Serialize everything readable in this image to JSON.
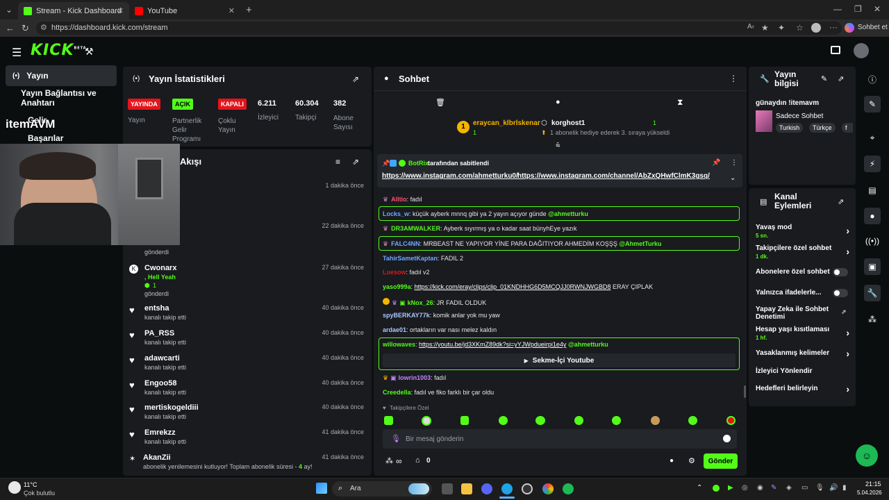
{
  "browser": {
    "tabs": [
      {
        "title": "Stream - Kick Dashboard"
      },
      {
        "title": "YouTube"
      }
    ],
    "url": "https://dashboard.kick.com/stream",
    "profile_label": "Sohbet et"
  },
  "kick": {
    "logo": "KICK",
    "beta": "BETA"
  },
  "sidebar": {
    "items": [
      {
        "label": "Yayın"
      },
      {
        "label": "Yayın Bağlantısı ve Anahtarı"
      },
      {
        "label": "Gelir"
      },
      {
        "label": "Başarılar"
      }
    ],
    "overlay": "itemAVM"
  },
  "stats": {
    "title": "Yayın İstatistikleri",
    "badges": [
      {
        "badge": "YAYINDA",
        "label": "Yayın",
        "color": "#e5141b"
      },
      {
        "badge": "AÇIK",
        "label": "Partnerlik Gelir Programı",
        "color": "#53fc18"
      },
      {
        "badge": "KAPALI",
        "label": "Çoklu Yayın",
        "color": "#e5141b"
      }
    ],
    "numbers": [
      {
        "value": "6.211",
        "label": "İzleyici"
      },
      {
        "value": "60.304",
        "label": "Takipçi"
      },
      {
        "value": "382",
        "label": "Abone Sayısı"
      }
    ]
  },
  "feed": {
    "title": "Akışı",
    "rows": [
      {
        "name": "",
        "sub": "",
        "time": "1 dakika önce"
      },
      {
        "name": "",
        "sub": "gönderdi",
        "time": "22 dakika önce"
      },
      {
        "name": "Cwonarx",
        "extra": ", Hell Yeah",
        "count": "1",
        "sub": "gönderdi",
        "time": "27 dakika önce"
      },
      {
        "name": "entsha",
        "sub": "kanalı takip etti",
        "time": "40 dakika önce"
      },
      {
        "name": "PA_RSS",
        "sub": "kanalı takip etti",
        "time": "40 dakika önce"
      },
      {
        "name": "adawcarti",
        "sub": "kanalı takip etti",
        "time": "40 dakika önce"
      },
      {
        "name": "Engoo58",
        "sub": "kanalı takip etti",
        "time": "40 dakika önce"
      },
      {
        "name": "mertiskogeldiii",
        "sub": "kanalı takip etti",
        "time": "40 dakika önce"
      },
      {
        "name": "Emrekzz",
        "sub": "kanalı takip etti",
        "time": "41 dakika önce"
      },
      {
        "name": "AkanZii",
        "sub": "abonelik yenilemesini kutluyor! Toplam abonelik süresi - ",
        "sub_count": "4",
        "sub_tail": " ay!",
        "time": "41 dakika önce"
      }
    ]
  },
  "chat": {
    "title": "Sohbet",
    "gift": {
      "user1": "eraycan_klbrlskenar",
      "count1": "1",
      "user2": "korghost1",
      "count2": "1",
      "note": "1 abonelik hediye ederek 3. sıraya yükseldi"
    },
    "pinned": {
      "by": "BotRix",
      "by_suffix": "tarafından sabitlendi",
      "link1": "https://www.instagram.com/ahmetturku0/",
      "link2": "https://www.instagram.com/channel/AbZxQHwfClmK3gsq/"
    },
    "messages": [
      {
        "user": "Alltio",
        "color": "#ff4d6d",
        "text": ": fadıl",
        "hl": false
      },
      {
        "user": "Locks_w",
        "color": "#6ea8ff",
        "text": ": küçük ayberk mnnq gibi ya 2 yayın açıyor günde ",
        "mention": "@ahmetturku",
        "hl": true
      },
      {
        "user": "DR3AMWALKER",
        "color": "#53fc18",
        "text": ": Ayberk sıyırmış ya o kadar saat bünyhEye yazık",
        "hl": false
      },
      {
        "user": "FALC4NN",
        "color": "#6ea8ff",
        "text": ": MRBEAST NE YAPIYOR YİNE PARA DAĞITIYOR AHMEDİM KOŞŞŞ ",
        "mention": "@AhmetTurku",
        "hl": true
      },
      {
        "user": "TahirSametKaptan",
        "color": "#6ea8ff",
        "text": ": FADIL 2",
        "hl": false
      },
      {
        "user": "Luesow",
        "color": "#e5141b",
        "text": ": fadıl v2",
        "hl": false
      },
      {
        "user": "yaso999a",
        "color": "#53fc18",
        "text": ": ",
        "link": "https://kick.com/eray/clips/clip_01KNDHHG6D5MCQJJ0RWNJWGBD8",
        "tail": " ERAY ÇIPLAK",
        "hl": false
      },
      {
        "user": "kNox_26",
        "color": "#53fc18",
        "text": ": JR FADIL OLDUK",
        "hl": false
      },
      {
        "user": "spyBERKAY77k",
        "color": "#a9c7ff",
        "text": ": komik anlar yok mu yaw",
        "hl": false
      },
      {
        "user": "ardae01",
        "color": "#a9c7ff",
        "text": ": ortakların var nası melez kaldın",
        "hl": false
      },
      {
        "user": "willowaves",
        "color": "#53fc18",
        "text": ": ",
        "link": "https://youtu.be/jd3XKmZ89dk?si=yYJWpdueirpi1e4y",
        "mention": "@ahmetturku",
        "hl": true
      },
      {
        "user": "lowrin1003",
        "color": "#c084fc",
        "text": ": fadıl",
        "hl": false
      },
      {
        "user": "Creedella",
        "color": "#53fc18",
        "text": ": fadıl ve fiko farklı bir çar oldu",
        "hl": false
      }
    ],
    "youtube_button": "Sekme-İçi Youtube",
    "followers_only": "Takipçilere Özel",
    "input_placeholder": "Bir mesaj gönderin",
    "points": "0",
    "send_label": "Gönder",
    "infinity": "∞"
  },
  "info": {
    "title_l1": "Yayın",
    "title_l2": "bilgisi",
    "stream_title": "günaydın !itemavm",
    "category": "Sadece Sohbet",
    "tags": [
      "Turkish",
      "Türkçe",
      "f"
    ]
  },
  "actions": {
    "title_l1": "Kanal",
    "title_l2": "Eylemleri",
    "items": [
      {
        "label": "Yavaş mod",
        "sub": "5 sn.",
        "control": "chevron"
      },
      {
        "label": "Takipçilere özel sohbet",
        "sub": "1 dk.",
        "control": "chevron"
      },
      {
        "label": "Abonelere özel sohbet",
        "sub": "",
        "control": "toggle"
      },
      {
        "label": "Yalnızca ifadelerle...",
        "sub": "",
        "control": "toggle"
      },
      {
        "label": "Yapay Zeka ile Sohbet Denetimi",
        "sub": "",
        "control": "external"
      },
      {
        "label": "Hesap yaşı kısıtlaması",
        "sub": "1 hf.",
        "control": "chevron"
      },
      {
        "label": "Yasaklanmış kelimeler",
        "sub": "",
        "control": "chevron"
      },
      {
        "label": "İzleyici Yönlendir",
        "sub": "",
        "control": "none"
      },
      {
        "label": "Hedefleri belirleyin",
        "sub": "",
        "control": "chevron"
      }
    ]
  },
  "taskbar": {
    "weather_temp": "11°C",
    "weather_desc": "Çok bulutlu",
    "search": "Ara",
    "time": "21:15",
    "date": "5.04.2026"
  }
}
